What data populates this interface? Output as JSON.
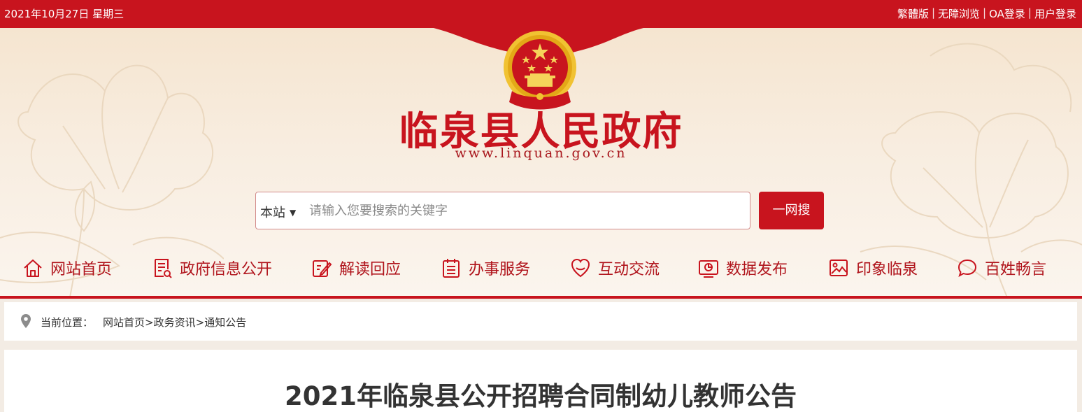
{
  "topbar": {
    "date": "2021年10月27日 星期三",
    "links": [
      "繁體版",
      "无障浏览",
      "OA登录",
      "用户登录"
    ],
    "separator": "|"
  },
  "header": {
    "site_name": "临泉县人民政府",
    "site_url": "www.linquan.gov.cn"
  },
  "search": {
    "scope": "本站",
    "placeholder": "请输入您要搜索的关键字",
    "value": "",
    "button": "一网搜"
  },
  "nav": [
    {
      "label": "网站首页",
      "icon": "home-icon"
    },
    {
      "label": "政府信息公开",
      "icon": "document-icon"
    },
    {
      "label": "解读回应",
      "icon": "edit-icon"
    },
    {
      "label": "办事服务",
      "icon": "calendar-list-icon"
    },
    {
      "label": "互动交流",
      "icon": "interaction-icon"
    },
    {
      "label": "数据发布",
      "icon": "chart-icon"
    },
    {
      "label": "印象临泉",
      "icon": "image-icon"
    },
    {
      "label": "百姓畅言",
      "icon": "chat-icon"
    }
  ],
  "breadcrumb": {
    "label": "当前位置：",
    "items": [
      "网站首页",
      "政务资讯",
      "通知公告"
    ],
    "separator": ">"
  },
  "article": {
    "title": "2021年临泉县公开招聘合同制幼儿教师公告"
  },
  "colors": {
    "primary_red": "#c8141e",
    "gold": "#f1c232"
  }
}
